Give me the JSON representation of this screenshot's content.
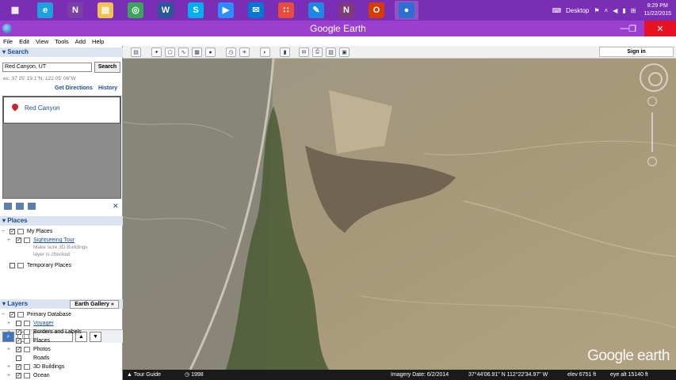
{
  "taskbar": {
    "apps": [
      {
        "name": "windows-logo-icon",
        "glyph": "▦"
      },
      {
        "name": "internet-explorer-icon",
        "glyph": "e"
      },
      {
        "name": "onenote-icon",
        "glyph": "N"
      },
      {
        "name": "file-explorer-icon",
        "glyph": "▤"
      },
      {
        "name": "chrome-icon",
        "glyph": "◎"
      },
      {
        "name": "word-icon",
        "glyph": "W"
      },
      {
        "name": "skype-icon",
        "glyph": "S"
      },
      {
        "name": "video-call-icon",
        "glyph": "▶"
      },
      {
        "name": "mail-icon",
        "glyph": "✉"
      },
      {
        "name": "apps-grid-icon",
        "glyph": "∷"
      },
      {
        "name": "pen-icon",
        "glyph": "✎"
      },
      {
        "name": "onenote2-icon",
        "glyph": "N"
      },
      {
        "name": "office-icon",
        "glyph": "O"
      },
      {
        "name": "google-earth-icon",
        "glyph": "●"
      }
    ],
    "desktop_label": "Desktop",
    "time": "8:29 PM",
    "date": "11/22/2015"
  },
  "window": {
    "title": "Google Earth"
  },
  "menu": [
    "File",
    "Edit",
    "View",
    "Tools",
    "Add",
    "Help"
  ],
  "toolbar": {
    "signin_label": "Sign in"
  },
  "search": {
    "header": "Search",
    "input_value": "Red Canyon, UT",
    "button_label": "Search",
    "hint": "ex: 37 25' 19.1\"N, 122 05' 06\"W",
    "get_directions": "Get Directions",
    "history": "History",
    "result": "Red Canyon"
  },
  "places": {
    "header": "Places",
    "my_places": "My Places",
    "sightseeing": "Sightseeing Tour",
    "note_line1": "Make sure 3D Buildings",
    "note_line2": "layer is checked",
    "temporary": "Temporary Places"
  },
  "layers": {
    "header": "Layers",
    "gallery": "Earth Gallery",
    "gallery_arrow": "»",
    "items": [
      "Primary Database",
      "Voyager",
      "Borders and Labels",
      "Places",
      "Photos",
      "Roads",
      "3D Buildings",
      "Ocean"
    ]
  },
  "status": {
    "tour_guide": "Tour Guide",
    "year": "1998",
    "imagery_date": "Imagery Date: 6/2/2014",
    "coords": "37°44'06.91\" N  112°22'34.97\" W",
    "elev": "elev  6751 ft",
    "eye_alt": "eye alt  15140 ft"
  },
  "map": {
    "watermark": "Google earth"
  }
}
